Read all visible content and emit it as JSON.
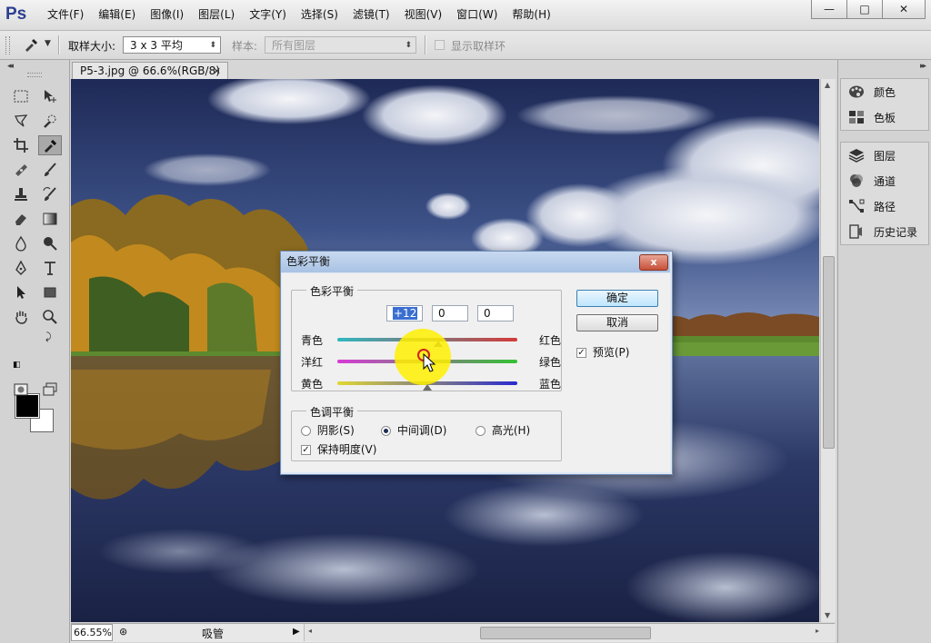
{
  "app": {
    "logo": "Ps"
  },
  "menu": [
    "文件(F)",
    "编辑(E)",
    "图像(I)",
    "图层(L)",
    "文字(Y)",
    "选择(S)",
    "滤镜(T)",
    "视图(V)",
    "窗口(W)",
    "帮助(H)"
  ],
  "window_controls": {
    "minimize": "—",
    "restore": "□",
    "close": "✕"
  },
  "options": {
    "sample_size_label": "取样大小:",
    "sample_size_value": "3 x 3 平均",
    "sample_label": "样本:",
    "sample_value": "所有图层",
    "show_ring_label": "显示取样环",
    "show_ring_checked": false
  },
  "document": {
    "tab_title": "P5-3.jpg @ 66.6%(RGB/8)",
    "zoom": "66.55%",
    "status": "吸管"
  },
  "panels": {
    "group1": [
      {
        "label": "颜色",
        "icon": "palette-icon"
      },
      {
        "label": "色板",
        "icon": "swatches-icon"
      }
    ],
    "group2": [
      {
        "label": "图层",
        "icon": "layers-icon"
      },
      {
        "label": "通道",
        "icon": "channels-icon"
      },
      {
        "label": "路径",
        "icon": "paths-icon"
      },
      {
        "label": "历史记录",
        "icon": "history-icon"
      }
    ]
  },
  "dialog": {
    "title": "色彩平衡",
    "close": "x",
    "color_balance_legend": "色彩平衡",
    "levels": [
      "+12",
      "0",
      "0"
    ],
    "sliders": [
      {
        "left": "青色",
        "right": "红色",
        "value": 12
      },
      {
        "left": "洋红",
        "right": "绿色",
        "value": 0
      },
      {
        "left": "黄色",
        "right": "蓝色",
        "value": 0
      }
    ],
    "tone_balance_legend": "色调平衡",
    "tones": [
      {
        "label": "阴影(S)",
        "selected": false
      },
      {
        "label": "中间调(D)",
        "selected": true
      },
      {
        "label": "高光(H)",
        "selected": false
      }
    ],
    "preserve_luminosity": {
      "label": "保持明度(V)",
      "checked": true
    },
    "ok": "确定",
    "cancel": "取消",
    "preview": {
      "label": "预览(P)",
      "checked": true
    }
  },
  "colors": {
    "foreground": "#000000",
    "background": "#ffffff",
    "accent": "#2c3f8f"
  }
}
